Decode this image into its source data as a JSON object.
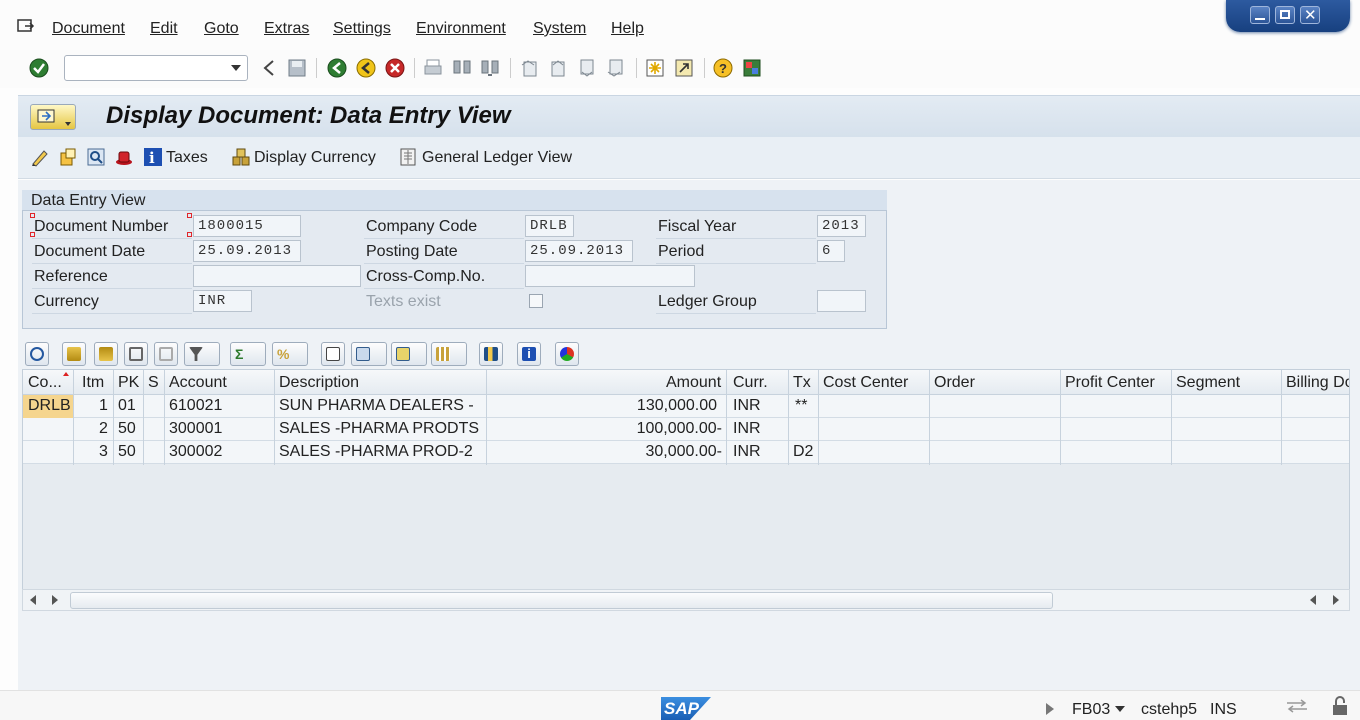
{
  "menu": {
    "items": [
      {
        "label": "Document"
      },
      {
        "label": "Edit"
      },
      {
        "label": "Goto"
      },
      {
        "label": "Extras"
      },
      {
        "label": "Settings"
      },
      {
        "label": "Environment"
      },
      {
        "label": "System"
      },
      {
        "label": "Help"
      }
    ]
  },
  "toolbar": {
    "command_value": "",
    "icons": [
      "enter-icon",
      "back-icon",
      "save-icon",
      "exit-icon",
      "cancel-icon",
      "print-icon",
      "find-icon",
      "find-next-icon",
      "first-page-icon",
      "prev-page-icon",
      "next-page-icon",
      "last-page-icon",
      "create-session-icon",
      "shortcut-icon",
      "help-icon",
      "customize-layout-icon"
    ]
  },
  "title": "Display Document: Data Entry View",
  "app_toolbar": {
    "taxes_label": "Taxes",
    "display_currency_label": "Display Currency",
    "gl_view_label": "General Ledger View"
  },
  "header": {
    "section_title": "Data Entry View",
    "document_number_label": "Document Number",
    "document_number": "1800015",
    "company_code_label": "Company Code",
    "company_code": "DRLB",
    "fiscal_year_label": "Fiscal Year",
    "fiscal_year": "2013",
    "document_date_label": "Document Date",
    "document_date": "25.09.2013",
    "posting_date_label": "Posting Date",
    "posting_date": "25.09.2013",
    "period_label": "Period",
    "period": "6",
    "reference_label": "Reference",
    "reference": "",
    "cross_comp_label": "Cross-Comp.No.",
    "cross_comp": "",
    "currency_label": "Currency",
    "currency": "INR",
    "texts_exist_label": "Texts exist",
    "ledger_group_label": "Ledger Group",
    "ledger_group": ""
  },
  "table": {
    "columns": [
      "Co...",
      "Itm",
      "PK",
      "S",
      "Account",
      "Description",
      "Amount",
      "Curr.",
      "Tx",
      "Cost Center",
      "Order",
      "Profit Center",
      "Segment",
      "Billing Do"
    ],
    "rows": [
      {
        "co": "DRLB",
        "itm": "1",
        "pk": "01",
        "s": "",
        "account": "610021",
        "description": "SUN PHARMA DEALERS -",
        "amount": "130,000.00",
        "curr": "INR",
        "tx": "**"
      },
      {
        "co": "",
        "itm": "2",
        "pk": "50",
        "s": "",
        "account": "300001",
        "description": "SALES -PHARMA PRODTS",
        "amount": "100,000.00-",
        "curr": "INR",
        "tx": ""
      },
      {
        "co": "",
        "itm": "3",
        "pk": "50",
        "s": "",
        "account": "300002",
        "description": "SALES -PHARMA PROD-2",
        "amount": "30,000.00-",
        "curr": "INR",
        "tx": "D2"
      }
    ]
  },
  "status": {
    "logo": "SAP",
    "transaction": "FB03",
    "server": "cstehp5",
    "mode": "INS"
  },
  "colors": {
    "accent": "#1a5fb4",
    "highlight_cell": "#f5d58e",
    "title_bg": "#dde6ef"
  }
}
